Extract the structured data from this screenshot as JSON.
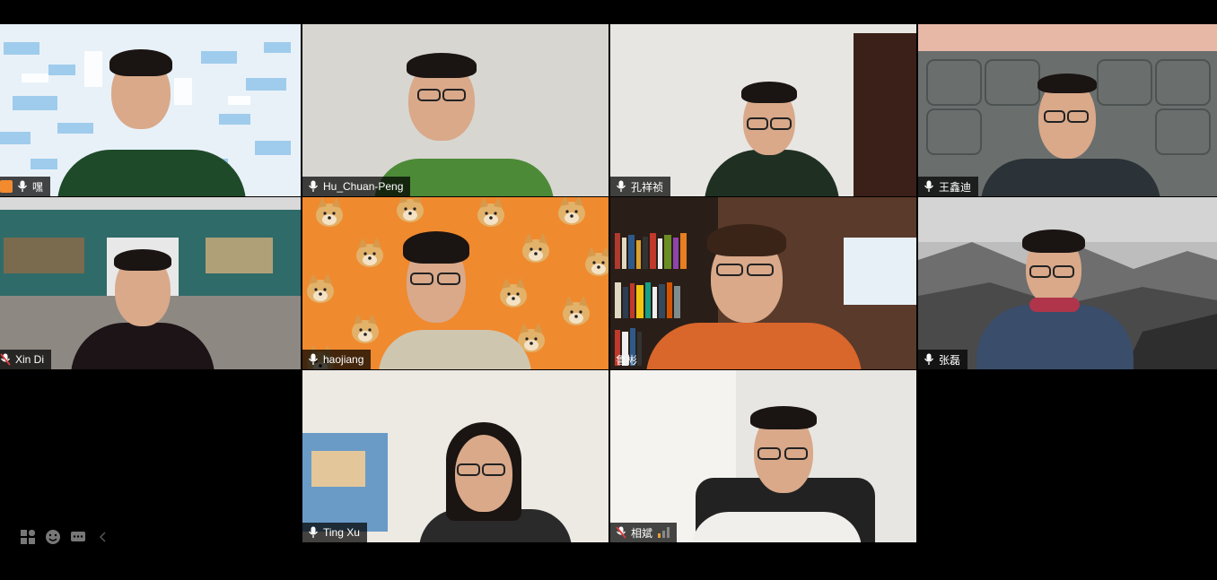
{
  "participants": [
    {
      "name": "嘿",
      "icon": "mic-icon",
      "muted": false,
      "bg": "#dbe9f3",
      "shirt": "#1f4a2a"
    },
    {
      "name": "Hu_Chuan-Peng",
      "icon": "mic-icon",
      "muted": false,
      "bg": "#d6d4cf",
      "shirt": "#4c8a38"
    },
    {
      "name": "孔祥祯",
      "icon": "mic-icon",
      "muted": false,
      "bg": "#e7e6e2",
      "shirt": "#1f3023"
    },
    {
      "name": "王鑫迪",
      "icon": "mic-icon",
      "muted": false,
      "bg": "#6a6f6d",
      "shirt": "#2b3338"
    },
    {
      "name": "Xin Di",
      "icon": "mic-muted-icon",
      "muted": true,
      "bg": "#7a8a86",
      "shirt": "#1c1417"
    },
    {
      "name": "haojiang",
      "icon": "mic-icon",
      "muted": false,
      "bg": "#f08a2e",
      "shirt": "#cfc6b0"
    },
    {
      "name": "鲁彬",
      "icon": "",
      "muted": false,
      "bg": "#5a3a2a",
      "shirt": "#d9662a"
    },
    {
      "name": "张磊",
      "icon": "mic-icon",
      "muted": false,
      "bg": "#8a8a8a",
      "shirt": "#3a4d6a"
    },
    {
      "name": "Ting Xu",
      "icon": "mic-icon",
      "muted": false,
      "bg": "#ede9e3",
      "shirt": "#2a2a2a"
    },
    {
      "name": "相斌",
      "icon": "mic-muted-icon",
      "muted": true,
      "bg": "#e8e6e2",
      "shirt": "#f1efeb"
    }
  ],
  "toolbar": [
    "gallery-view-icon",
    "reaction-icon",
    "chat-icon",
    "collapse-arrow-icon"
  ]
}
